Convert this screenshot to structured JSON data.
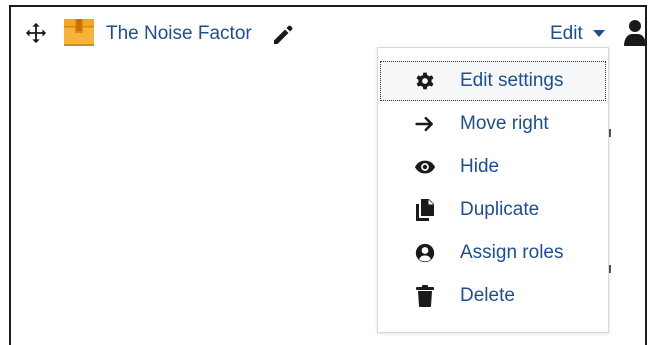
{
  "activity": {
    "title": "The Noise Factor",
    "icons": {
      "move": "move-arrows-icon",
      "type": "package-box-icon",
      "edit_title": "pencil-icon",
      "user": "user-icon"
    }
  },
  "edit_menu": {
    "toggle_label": "Edit",
    "items": [
      {
        "label": "Edit settings",
        "icon": "gear-icon"
      },
      {
        "label": "Move right",
        "icon": "arrow-right-icon"
      },
      {
        "label": "Hide",
        "icon": "eye-icon"
      },
      {
        "label": "Duplicate",
        "icon": "copy-icon"
      },
      {
        "label": "Assign roles",
        "icon": "user-circle-icon"
      },
      {
        "label": "Delete",
        "icon": "trash-icon"
      }
    ]
  },
  "colors": {
    "link": "#1f4e8c",
    "icon_dark": "#1a1a1a",
    "box_orange": "#f7b23b",
    "box_dark": "#d98a13"
  }
}
